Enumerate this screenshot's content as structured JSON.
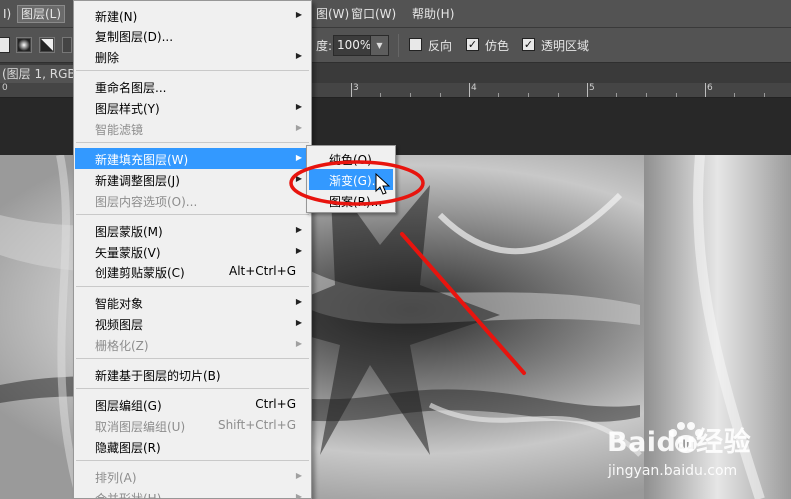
{
  "menubar": {
    "items": [
      {
        "label": "I)"
      },
      {
        "label": "图层(L)"
      },
      {
        "label": "图(W)"
      },
      {
        "label": "窗口(W)"
      },
      {
        "label": "帮助(H)"
      }
    ]
  },
  "options": {
    "opacity_label": "度:",
    "opacity_value": "100%",
    "reverse_label": "反向",
    "dither_label": "仿色",
    "transparency_label": "透明区域"
  },
  "document": {
    "tab_title": "(图层 1, RGB/"
  },
  "ruler": {
    "labels": [
      "0",
      "3",
      "4",
      "5",
      "6"
    ]
  },
  "layer_menu": {
    "items": [
      {
        "label": "新建(N)",
        "submenu": true
      },
      {
        "label": "复制图层(D)..."
      },
      {
        "label": "删除",
        "submenu": true
      },
      {
        "label": "重命名图层..."
      },
      {
        "label": "图层样式(Y)",
        "submenu": true
      },
      {
        "label": "智能滤镜",
        "submenu": true,
        "disabled": true
      },
      {
        "label": "新建填充图层(W)",
        "submenu": true,
        "highlighted": true
      },
      {
        "label": "新建调整图层(J)",
        "submenu": true
      },
      {
        "label": "图层内容选项(O)...",
        "disabled": true
      },
      {
        "label": "图层蒙版(M)",
        "submenu": true
      },
      {
        "label": "矢量蒙版(V)",
        "submenu": true
      },
      {
        "label": "创建剪贴蒙版(C)",
        "shortcut": "Alt+Ctrl+G"
      },
      {
        "label": "智能对象",
        "submenu": true
      },
      {
        "label": "视频图层",
        "submenu": true
      },
      {
        "label": "栅格化(Z)",
        "submenu": true,
        "disabled": true
      },
      {
        "label": "新建基于图层的切片(B)"
      },
      {
        "label": "图层编组(G)",
        "shortcut": "Ctrl+G"
      },
      {
        "label": "取消图层编组(U)",
        "shortcut": "Shift+Ctrl+G",
        "disabled": true
      },
      {
        "label": "隐藏图层(R)"
      },
      {
        "label": "排列(A)",
        "submenu": true,
        "disabled": true
      },
      {
        "label": "合并形状(H)",
        "submenu": true,
        "disabled": true
      }
    ]
  },
  "fill_submenu": {
    "items": [
      {
        "label": "纯色(O)..."
      },
      {
        "label": "渐变(G)...",
        "highlighted": true
      },
      {
        "label": "图案(R)..."
      }
    ]
  },
  "watermark": {
    "brand": "Baidu经验",
    "url": "jingyan.baidu.com"
  },
  "colors": {
    "highlight": "#3399ff",
    "annotation": "#e8140e",
    "menu_bg": "#f0f0f0"
  }
}
